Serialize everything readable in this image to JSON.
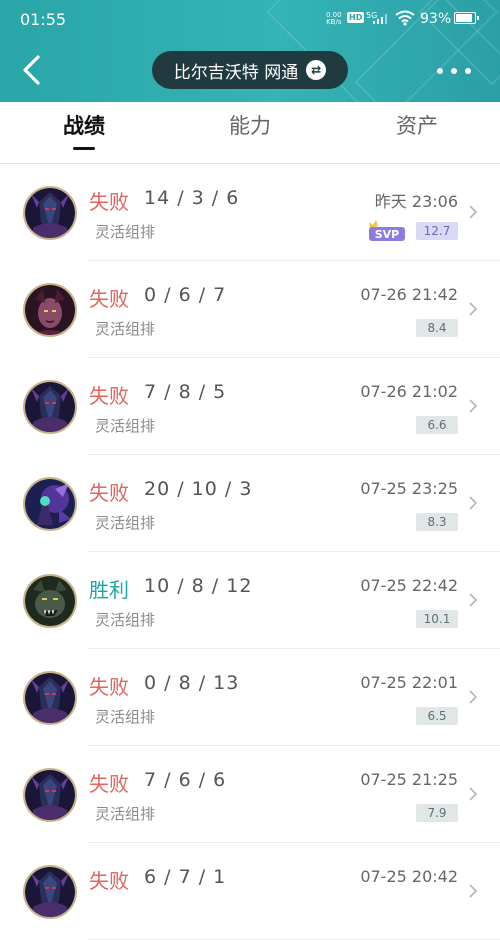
{
  "status_bar": {
    "time": "01:55",
    "net_speed_value": "0.00",
    "net_speed_unit": "KB/s",
    "hd": "HD",
    "signal": "5G",
    "battery": "93%"
  },
  "header": {
    "server": "比尔吉沃特 网通",
    "swap_glyph": "⇄"
  },
  "tabs": [
    {
      "label": "战绩",
      "active": true
    },
    {
      "label": "能力",
      "active": false
    },
    {
      "label": "资产",
      "active": false
    }
  ],
  "matches": [
    {
      "result": "失败",
      "outcome": "lose",
      "kda": "14 / 3 / 6",
      "mode": "灵活组排",
      "time": "昨天 23:06",
      "score": "12.7",
      "svp": true,
      "svp_label": "SVP",
      "hero": "dark-knight"
    },
    {
      "result": "失败",
      "outcome": "lose",
      "kda": "0 / 6 / 7",
      "mode": "灵活组排",
      "time": "07-26 21:42",
      "score": "8.4",
      "svp": false,
      "hero": "demon-woman"
    },
    {
      "result": "失败",
      "outcome": "lose",
      "kda": "7 / 8 / 5",
      "mode": "灵活组排",
      "time": "07-26 21:02",
      "score": "6.6",
      "svp": false,
      "hero": "dark-knight"
    },
    {
      "result": "失败",
      "outcome": "lose",
      "kda": "20 / 10 / 3",
      "mode": "灵活组排",
      "time": "07-25 23:25",
      "score": "8.3",
      "svp": false,
      "hero": "void-mage"
    },
    {
      "result": "胜利",
      "outcome": "win",
      "kda": "10 / 8 / 12",
      "mode": "灵活组排",
      "time": "07-25 22:42",
      "score": "10.1",
      "svp": false,
      "hero": "werewolf"
    },
    {
      "result": "失败",
      "outcome": "lose",
      "kda": "0 / 8 / 13",
      "mode": "灵活组排",
      "time": "07-25 22:01",
      "score": "6.5",
      "svp": false,
      "hero": "dark-knight"
    },
    {
      "result": "失败",
      "outcome": "lose",
      "kda": "7 / 6 / 6",
      "mode": "灵活组排",
      "time": "07-25 21:25",
      "score": "7.9",
      "svp": false,
      "hero": "dark-knight"
    },
    {
      "result": "失败",
      "outcome": "lose",
      "kda": "6 / 7 / 1",
      "mode": "",
      "time": "07-25 20:42",
      "score": "",
      "svp": false,
      "hero": "dark-knight"
    }
  ],
  "colors": {
    "header": "#2aa5a8",
    "lose": "#e2645d",
    "win": "#1ea6a6",
    "pill": "#1f3b3f"
  }
}
